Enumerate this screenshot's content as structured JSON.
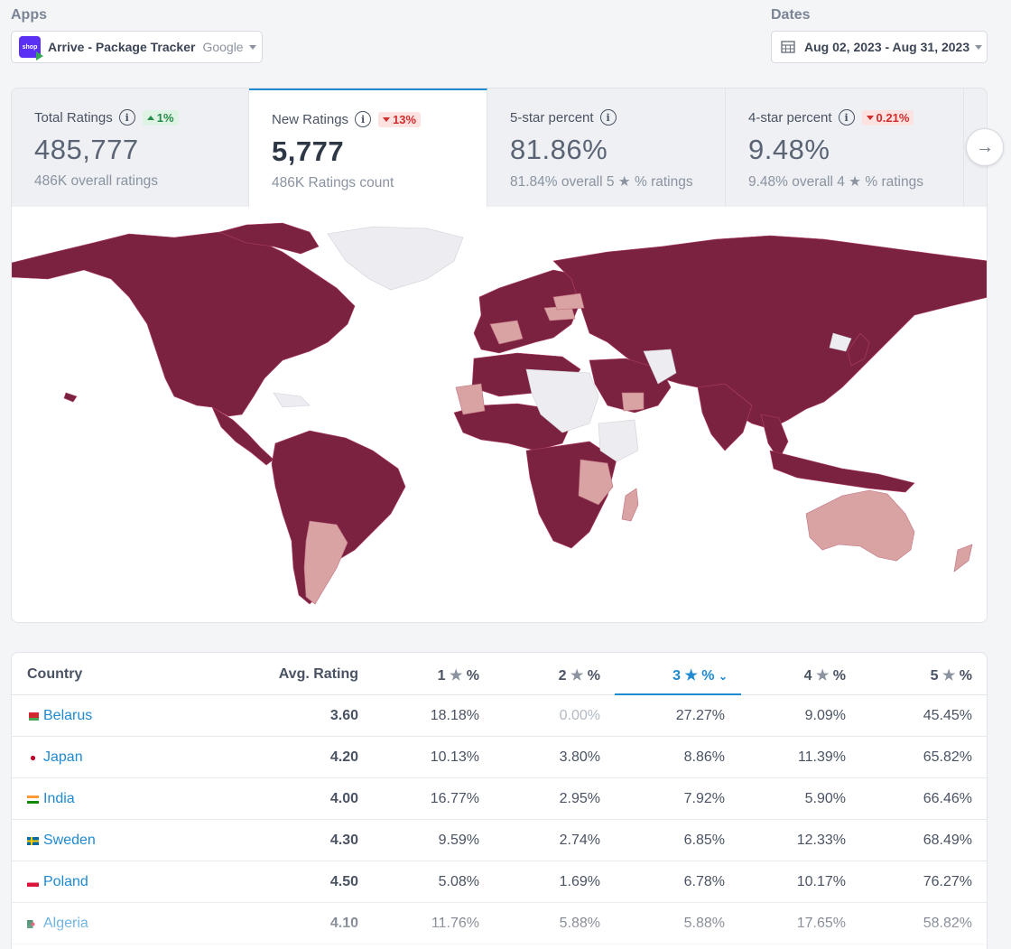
{
  "apps": {
    "label": "Apps",
    "selected_app": "Arrive - Package Tracker",
    "store": "Google",
    "logo_text": "shop"
  },
  "dates": {
    "label": "Dates",
    "range": "Aug 02, 2023 - Aug 31, 2023"
  },
  "metrics": [
    {
      "title": "Total Ratings",
      "delta": "1%",
      "delta_dir": "up",
      "value": "485,777",
      "sub": "486K overall ratings"
    },
    {
      "title": "New Ratings",
      "delta": "13%",
      "delta_dir": "down",
      "value": "5,777",
      "sub": "486K Ratings count"
    },
    {
      "title": "5-star percent",
      "delta": "",
      "value": "81.86%",
      "sub_pre": "81.84% overall 5",
      "sub_post": "% ratings"
    },
    {
      "title": "4-star percent",
      "delta": "0.21%",
      "delta_dir": "down",
      "value": "9.48%",
      "sub_pre": "9.48% overall 4",
      "sub_post": "% ratings"
    }
  ],
  "map": {
    "colors": {
      "high": "#7b2241",
      "medium": "#d9a3a3",
      "none": "#ececf1",
      "border": "#b04060"
    }
  },
  "table": {
    "headers": {
      "country": "Country",
      "avg": "Avg. Rating",
      "s1": "1",
      "s2": "2",
      "s3": "3",
      "s4": "4",
      "s5": "5",
      "pct": "%"
    },
    "sorted_column": "3",
    "rows": [
      {
        "country": "Belarus",
        "avg": "3.60",
        "s1": "18.18%",
        "s2": "0.00%",
        "s3": "27.27%",
        "s4": "9.09%",
        "s5": "45.45%"
      },
      {
        "country": "Japan",
        "avg": "4.20",
        "s1": "10.13%",
        "s2": "3.80%",
        "s3": "8.86%",
        "s4": "11.39%",
        "s5": "65.82%"
      },
      {
        "country": "India",
        "avg": "4.00",
        "s1": "16.77%",
        "s2": "2.95%",
        "s3": "7.92%",
        "s4": "5.90%",
        "s5": "66.46%"
      },
      {
        "country": "Sweden",
        "avg": "4.30",
        "s1": "9.59%",
        "s2": "2.74%",
        "s3": "6.85%",
        "s4": "12.33%",
        "s5": "68.49%"
      },
      {
        "country": "Poland",
        "avg": "4.50",
        "s1": "5.08%",
        "s2": "1.69%",
        "s3": "6.78%",
        "s4": "10.17%",
        "s5": "76.27%"
      },
      {
        "country": "Algeria",
        "avg": "4.10",
        "s1": "11.76%",
        "s2": "5.88%",
        "s3": "5.88%",
        "s4": "17.65%",
        "s5": "58.82%"
      }
    ]
  }
}
